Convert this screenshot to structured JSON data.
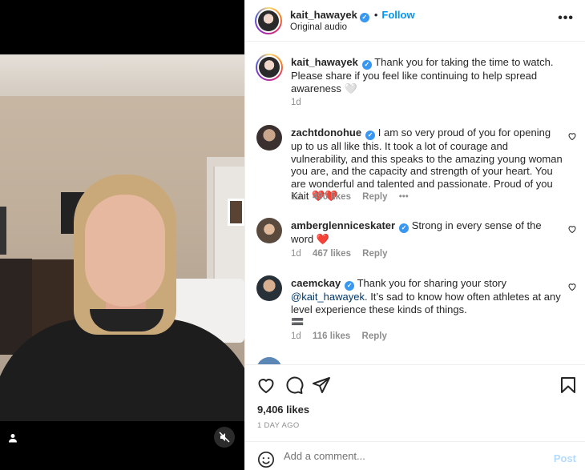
{
  "header": {
    "username": "kait_hawayek",
    "follow_label": "Follow",
    "audio": "Original audio",
    "separator": "•",
    "more_label": "•••"
  },
  "caption": {
    "username": "kait_hawayek",
    "text": "Thank you for taking the time to watch. Please share if you feel like continuing to help spread awareness 🤍",
    "time": "1d"
  },
  "comments": [
    {
      "username": "zachtdonohue",
      "text": "I am so very proud of you for opening up to us all like this. It took a lot of courage and vulnerability, and this speaks to the amazing young woman you are, and the capacity and strength of your heart. You are wonderful and talented and passionate. Proud of you Kait",
      "emoji": "❤️❤️",
      "time": "1d",
      "likes": "490 likes",
      "reply": "Reply",
      "more": "•••"
    },
    {
      "username": "amberglenniceskater",
      "text": "Strong in every sense of the word",
      "emoji": "❤️",
      "time": "1d",
      "likes": "467 likes",
      "reply": "Reply"
    },
    {
      "username": "caemckay",
      "text_before": "Thank you for sharing your story",
      "mention": "@kait_hawayek",
      "text_after": ". It’s sad to know how often athletes at any level experience these kinds of things.",
      "emoji": "🟰",
      "time": "1d",
      "likes": "116 likes",
      "reply": "Reply"
    }
  ],
  "actions": {
    "likes": "9,406 likes",
    "time_ago": "1 DAY AGO"
  },
  "add_comment": {
    "placeholder": "Add a comment...",
    "post_label": "Post"
  },
  "colors": {
    "accent": "#0095f6",
    "verified": "#3897f0",
    "heart": "#ed4956",
    "muted": "#8e8e8e"
  },
  "icons": [
    "verified-icon",
    "more-icon",
    "heart-icon",
    "comment-icon",
    "share-icon",
    "bookmark-icon",
    "emoji-icon",
    "user-tag-icon",
    "mute-icon"
  ]
}
